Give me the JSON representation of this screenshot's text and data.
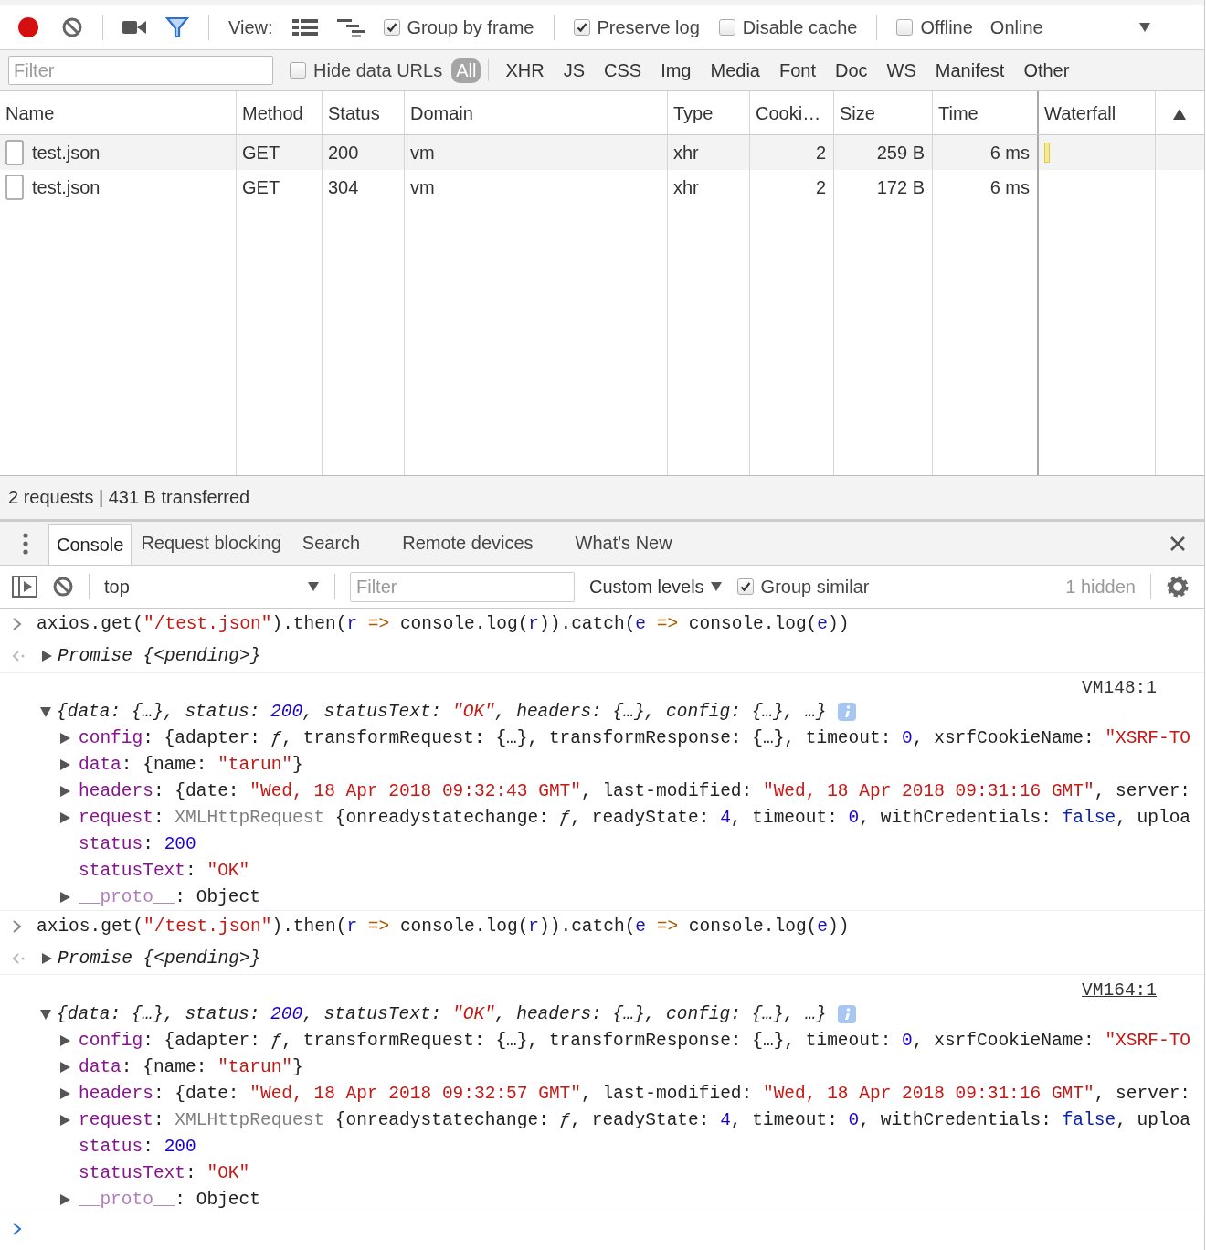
{
  "toolbar": {
    "recording": true,
    "filter_active": true,
    "view_label": "View:",
    "checkbox_groups": [
      [
        {
          "label": "Group by frame",
          "checked": true
        }
      ],
      [
        {
          "label": "Preserve log",
          "checked": true
        },
        {
          "label": "Disable cache",
          "checked": false
        }
      ],
      [
        {
          "label": "Offline",
          "checked": false
        }
      ]
    ],
    "throttling": "Online"
  },
  "filter_bar": {
    "placeholder": "Filter",
    "hide_data_urls": {
      "label": "Hide data URLs",
      "checked": false
    },
    "types": [
      {
        "label": "All",
        "selected": true
      },
      {
        "label": "XHR",
        "selected": false
      },
      {
        "label": "JS",
        "selected": false
      },
      {
        "label": "CSS",
        "selected": false
      },
      {
        "label": "Img",
        "selected": false
      },
      {
        "label": "Media",
        "selected": false
      },
      {
        "label": "Font",
        "selected": false
      },
      {
        "label": "Doc",
        "selected": false
      },
      {
        "label": "WS",
        "selected": false
      },
      {
        "label": "Manifest",
        "selected": false
      },
      {
        "label": "Other",
        "selected": false
      }
    ]
  },
  "table": {
    "columns": [
      "Name",
      "Method",
      "Status",
      "Domain",
      "Type",
      "Cooki…",
      "Size",
      "Time",
      "Waterfall"
    ],
    "rows": [
      {
        "name": "test.json",
        "method": "GET",
        "status": "200",
        "domain": "vm",
        "type": "xhr",
        "cookies": "2",
        "size": "259 B",
        "time": "6 ms",
        "waterfall_bar": true
      },
      {
        "name": "test.json",
        "method": "GET",
        "status": "304",
        "domain": "vm",
        "type": "xhr",
        "cookies": "2",
        "size": "172 B",
        "time": "6 ms",
        "waterfall_bar": false
      }
    ]
  },
  "summary": "2 requests | 431 B transferred",
  "drawer": {
    "tabs": [
      {
        "label": "Console",
        "selected": true
      },
      {
        "label": "Request blocking",
        "selected": false
      },
      {
        "label": "Search",
        "selected": false
      },
      {
        "label": "Remote devices",
        "selected": false
      },
      {
        "label": "What's New",
        "selected": false
      }
    ]
  },
  "console_toolbar": {
    "context": "top",
    "filter_placeholder": "Filter",
    "levels": "Custom levels",
    "group_similar": {
      "label": "Group similar",
      "checked": true
    },
    "hidden_count": "1 hidden"
  },
  "console": {
    "messages": [
      {
        "kind": "input",
        "tokens": [
          {
            "kind": "plain",
            "text": "axios.get("
          },
          {
            "kind": "string",
            "text": "\"/test.json\""
          },
          {
            "kind": "plain",
            "text": ").then("
          },
          {
            "kind": "var",
            "text": "r"
          },
          {
            "kind": "operator",
            "text": " =>"
          },
          {
            "kind": "plain",
            "text": " console.log("
          },
          {
            "kind": "var",
            "text": "r"
          },
          {
            "kind": "plain",
            "text": ")).catch("
          },
          {
            "kind": "var",
            "text": "e"
          },
          {
            "kind": "operator",
            "text": " =>"
          },
          {
            "kind": "plain",
            "text": " console.log("
          },
          {
            "kind": "var",
            "text": "e"
          },
          {
            "kind": "plain",
            "text": "))"
          }
        ]
      },
      {
        "kind": "result",
        "expanded": false,
        "tokens": [
          {
            "kind": "plain",
            "text": "Promise {<pending>}"
          }
        ]
      },
      {
        "kind": "log",
        "source": "VM148:1",
        "expanded": true,
        "tokens": [
          {
            "kind": "plain",
            "text": "{data: {…}, status: "
          },
          {
            "kind": "number",
            "text": "200"
          },
          {
            "kind": "plain",
            "text": ", statusText: "
          },
          {
            "kind": "string",
            "text": "\"OK\""
          },
          {
            "kind": "plain",
            "text": ", headers: {…}, config: {…}, …}"
          }
        ],
        "children": [
          {
            "kind": "expandable",
            "expanded": false,
            "tokens": [
              {
                "kind": "key",
                "text": "config"
              },
              {
                "kind": "plain",
                "text": ": {adapter: "
              },
              {
                "kind": "func",
                "text": "ƒ"
              },
              {
                "kind": "plain",
                "text": ", transformRequest: {…}, transformResponse: {…}, timeout: "
              },
              {
                "kind": "number",
                "text": "0"
              },
              {
                "kind": "plain",
                "text": ", xsrfCookieName: "
              },
              {
                "kind": "string",
                "text": "\"XSRF-TO"
              }
            ]
          },
          {
            "kind": "expandable",
            "expanded": false,
            "tokens": [
              {
                "kind": "key",
                "text": "data"
              },
              {
                "kind": "plain",
                "text": ": {name: "
              },
              {
                "kind": "string",
                "text": "\"tarun\""
              },
              {
                "kind": "plain",
                "text": "}"
              }
            ]
          },
          {
            "kind": "expandable",
            "expanded": false,
            "tokens": [
              {
                "kind": "key",
                "text": "headers"
              },
              {
                "kind": "plain",
                "text": ": {date: "
              },
              {
                "kind": "string",
                "text": "\"Wed, 18 Apr 2018 09:32:43 GMT\""
              },
              {
                "kind": "plain",
                "text": ", last-modified: "
              },
              {
                "kind": "string",
                "text": "\"Wed, 18 Apr 2018 09:31:16 GMT\""
              },
              {
                "kind": "plain",
                "text": ", server:"
              }
            ]
          },
          {
            "kind": "expandable",
            "expanded": false,
            "tokens": [
              {
                "kind": "key",
                "text": "request"
              },
              {
                "kind": "plain",
                "text": ": "
              },
              {
                "kind": "type",
                "text": "XMLHttpRequest"
              },
              {
                "kind": "plain",
                "text": " {onreadystatechange: "
              },
              {
                "kind": "func",
                "text": "ƒ"
              },
              {
                "kind": "plain",
                "text": ", readyState: "
              },
              {
                "kind": "number",
                "text": "4"
              },
              {
                "kind": "plain",
                "text": ", timeout: "
              },
              {
                "kind": "number",
                "text": "0"
              },
              {
                "kind": "plain",
                "text": ", withCredentials: "
              },
              {
                "kind": "bool",
                "text": "false"
              },
              {
                "kind": "plain",
                "text": ", uploa"
              }
            ]
          },
          {
            "kind": "value",
            "tokens": [
              {
                "kind": "key",
                "text": "status"
              },
              {
                "kind": "plain",
                "text": ": "
              },
              {
                "kind": "number",
                "text": "200"
              }
            ]
          },
          {
            "kind": "value",
            "tokens": [
              {
                "kind": "key",
                "text": "statusText"
              },
              {
                "kind": "plain",
                "text": ": "
              },
              {
                "kind": "string",
                "text": "\"OK\""
              }
            ]
          },
          {
            "kind": "expandable",
            "expanded": false,
            "tokens": [
              {
                "kind": "dimkey",
                "text": "__proto__"
              },
              {
                "kind": "plain",
                "text": ": Object"
              }
            ]
          }
        ]
      },
      {
        "kind": "input",
        "tokens": [
          {
            "kind": "plain",
            "text": "axios.get("
          },
          {
            "kind": "string",
            "text": "\"/test.json\""
          },
          {
            "kind": "plain",
            "text": ").then("
          },
          {
            "kind": "var",
            "text": "r"
          },
          {
            "kind": "operator",
            "text": " =>"
          },
          {
            "kind": "plain",
            "text": " console.log("
          },
          {
            "kind": "var",
            "text": "r"
          },
          {
            "kind": "plain",
            "text": ")).catch("
          },
          {
            "kind": "var",
            "text": "e"
          },
          {
            "kind": "operator",
            "text": " =>"
          },
          {
            "kind": "plain",
            "text": " console.log("
          },
          {
            "kind": "var",
            "text": "e"
          },
          {
            "kind": "plain",
            "text": "))"
          }
        ]
      },
      {
        "kind": "result",
        "expanded": false,
        "tokens": [
          {
            "kind": "plain",
            "text": "Promise {<pending>}"
          }
        ]
      },
      {
        "kind": "log",
        "source": "VM164:1",
        "expanded": true,
        "tokens": [
          {
            "kind": "plain",
            "text": "{data: {…}, status: "
          },
          {
            "kind": "number",
            "text": "200"
          },
          {
            "kind": "plain",
            "text": ", statusText: "
          },
          {
            "kind": "string",
            "text": "\"OK\""
          },
          {
            "kind": "plain",
            "text": ", headers: {…}, config: {…}, …}"
          }
        ],
        "children": [
          {
            "kind": "expandable",
            "expanded": false,
            "tokens": [
              {
                "kind": "key",
                "text": "config"
              },
              {
                "kind": "plain",
                "text": ": {adapter: "
              },
              {
                "kind": "func",
                "text": "ƒ"
              },
              {
                "kind": "plain",
                "text": ", transformRequest: {…}, transformResponse: {…}, timeout: "
              },
              {
                "kind": "number",
                "text": "0"
              },
              {
                "kind": "plain",
                "text": ", xsrfCookieName: "
              },
              {
                "kind": "string",
                "text": "\"XSRF-TO"
              }
            ]
          },
          {
            "kind": "expandable",
            "expanded": false,
            "tokens": [
              {
                "kind": "key",
                "text": "data"
              },
              {
                "kind": "plain",
                "text": ": {name: "
              },
              {
                "kind": "string",
                "text": "\"tarun\""
              },
              {
                "kind": "plain",
                "text": "}"
              }
            ]
          },
          {
            "kind": "expandable",
            "expanded": false,
            "tokens": [
              {
                "kind": "key",
                "text": "headers"
              },
              {
                "kind": "plain",
                "text": ": {date: "
              },
              {
                "kind": "string",
                "text": "\"Wed, 18 Apr 2018 09:32:57 GMT\""
              },
              {
                "kind": "plain",
                "text": ", last-modified: "
              },
              {
                "kind": "string",
                "text": "\"Wed, 18 Apr 2018 09:31:16 GMT\""
              },
              {
                "kind": "plain",
                "text": ", server:"
              }
            ]
          },
          {
            "kind": "expandable",
            "expanded": false,
            "tokens": [
              {
                "kind": "key",
                "text": "request"
              },
              {
                "kind": "plain",
                "text": ": "
              },
              {
                "kind": "type",
                "text": "XMLHttpRequest"
              },
              {
                "kind": "plain",
                "text": " {onreadystatechange: "
              },
              {
                "kind": "func",
                "text": "ƒ"
              },
              {
                "kind": "plain",
                "text": ", readyState: "
              },
              {
                "kind": "number",
                "text": "4"
              },
              {
                "kind": "plain",
                "text": ", timeout: "
              },
              {
                "kind": "number",
                "text": "0"
              },
              {
                "kind": "plain",
                "text": ", withCredentials: "
              },
              {
                "kind": "bool",
                "text": "false"
              },
              {
                "kind": "plain",
                "text": ", uploa"
              }
            ]
          },
          {
            "kind": "value",
            "tokens": [
              {
                "kind": "key",
                "text": "status"
              },
              {
                "kind": "plain",
                "text": ": "
              },
              {
                "kind": "number",
                "text": "200"
              }
            ]
          },
          {
            "kind": "value",
            "tokens": [
              {
                "kind": "key",
                "text": "statusText"
              },
              {
                "kind": "plain",
                "text": ": "
              },
              {
                "kind": "string",
                "text": "\"OK\""
              }
            ]
          },
          {
            "kind": "expandable",
            "expanded": false,
            "tokens": [
              {
                "kind": "dimkey",
                "text": "__proto__"
              },
              {
                "kind": "plain",
                "text": ": Object"
              }
            ]
          }
        ]
      }
    ]
  }
}
